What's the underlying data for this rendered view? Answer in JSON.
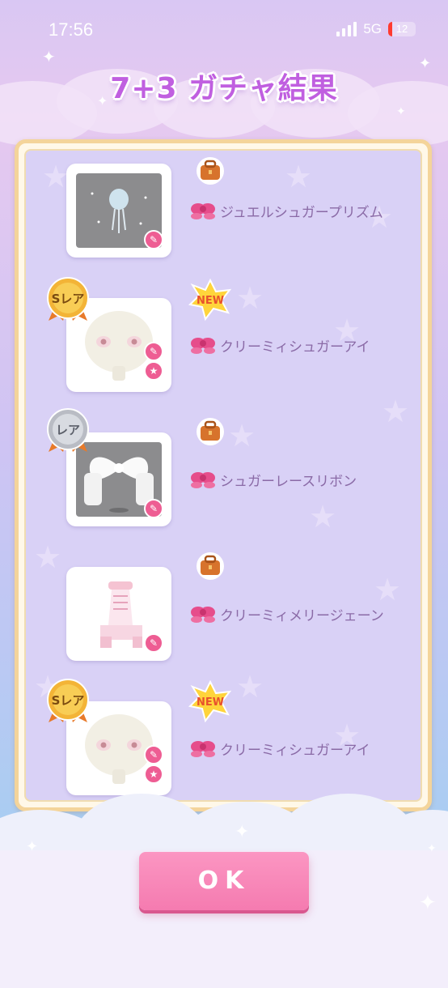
{
  "status_bar": {
    "time": "17:56",
    "network": "5G",
    "battery": "12"
  },
  "title": "7+3 ガチャ結果",
  "items": [
    {
      "name": "ジュエルシュガープリズム",
      "badge": "bag",
      "rarity": ""
    },
    {
      "name": "クリーミィシュガーアイ",
      "badge": "NEW",
      "rarity": "Sレア"
    },
    {
      "name": "シュガーレースリボン",
      "badge": "bag",
      "rarity": "レア"
    },
    {
      "name": "クリーミィメリージェーン",
      "badge": "bag",
      "rarity": ""
    },
    {
      "name": "クリーミィシュガーアイ",
      "badge": "NEW",
      "rarity": "Sレア"
    }
  ],
  "ok_button": "OK",
  "colors": {
    "title": "#c05fe0",
    "panel_border": "#f4d49a",
    "ok_button": "#f57bb0",
    "item_text": "#8a6aa6"
  }
}
